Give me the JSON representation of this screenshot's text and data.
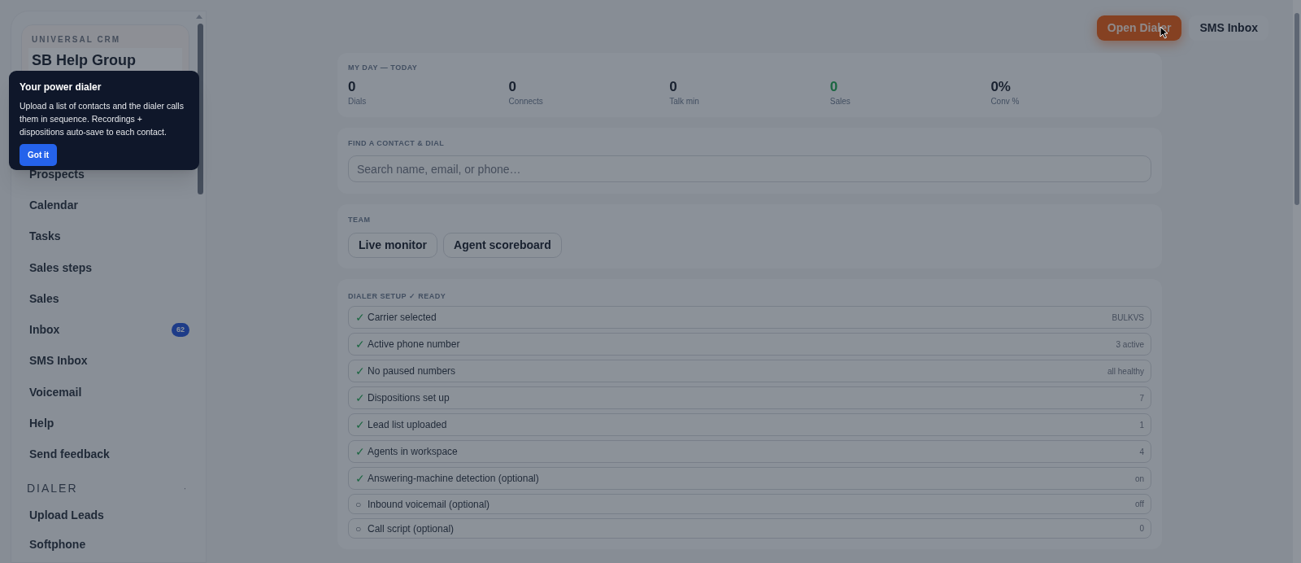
{
  "sidebar": {
    "brand_label": "UNIVERSAL CRM",
    "workspace_name": "SB Help Group",
    "items": [
      {
        "label": "Prospects"
      },
      {
        "label": "Calendar"
      },
      {
        "label": "Tasks"
      },
      {
        "label": "Sales steps"
      },
      {
        "label": "Sales"
      },
      {
        "label": "Inbox",
        "badge": "62"
      },
      {
        "label": "SMS Inbox"
      },
      {
        "label": "Voicemail"
      },
      {
        "label": "Help"
      },
      {
        "label": "Send feedback"
      }
    ],
    "sections": [
      {
        "title": "DIALER",
        "marker": "·",
        "items": [
          {
            "label": "Upload Leads"
          },
          {
            "label": "Softphone"
          }
        ]
      }
    ]
  },
  "tooltip": {
    "title": "Your power dialer",
    "body": "Upload a list of contacts and the dialer calls them in sequence. Recordings + dispositions auto-save to each contact.",
    "button": "Got it"
  },
  "header_buttons": [
    {
      "label": "Open Dialer",
      "kind": "primary"
    },
    {
      "label": "SMS Inbox",
      "kind": "secondary"
    }
  ],
  "my_day": {
    "title": "MY DAY — TODAY",
    "stats": [
      {
        "value": "0",
        "label": "Dials",
        "highlight": false
      },
      {
        "value": "0",
        "label": "Connects",
        "highlight": false
      },
      {
        "value": "0",
        "label": "Talk min",
        "highlight": false
      },
      {
        "value": "0",
        "label": "Sales",
        "highlight": true
      },
      {
        "value": "0%",
        "label": "Conv %",
        "highlight": false
      }
    ]
  },
  "find_contact": {
    "title": "FIND A CONTACT & DIAL",
    "placeholder": "Search name, email, or phone…"
  },
  "team": {
    "title": "TEAM",
    "buttons": [
      "Live monitor",
      "Agent scoreboard"
    ]
  },
  "dialer_setup": {
    "title": "DIALER SETUP ✓ READY",
    "steps": [
      {
        "mark": "✓",
        "label": "Carrier selected",
        "value": "BULKVS",
        "done": true
      },
      {
        "mark": "✓",
        "label": "Active phone number",
        "value": "3 active",
        "done": true
      },
      {
        "mark": "✓",
        "label": "No paused numbers",
        "value": "all healthy",
        "done": true
      },
      {
        "mark": "✓",
        "label": "Dispositions set up",
        "value": "7",
        "done": true
      },
      {
        "mark": "✓",
        "label": "Lead list uploaded",
        "value": "1",
        "done": true
      },
      {
        "mark": "✓",
        "label": "Agents in workspace",
        "value": "4",
        "done": true
      },
      {
        "mark": "✓",
        "label": "Answering-machine detection (optional)",
        "value": "on",
        "done": true
      },
      {
        "mark": "○",
        "label": "Inbound voicemail (optional)",
        "value": "off",
        "done": false
      },
      {
        "mark": "○",
        "label": "Call script (optional)",
        "value": "0",
        "done": false
      }
    ]
  }
}
